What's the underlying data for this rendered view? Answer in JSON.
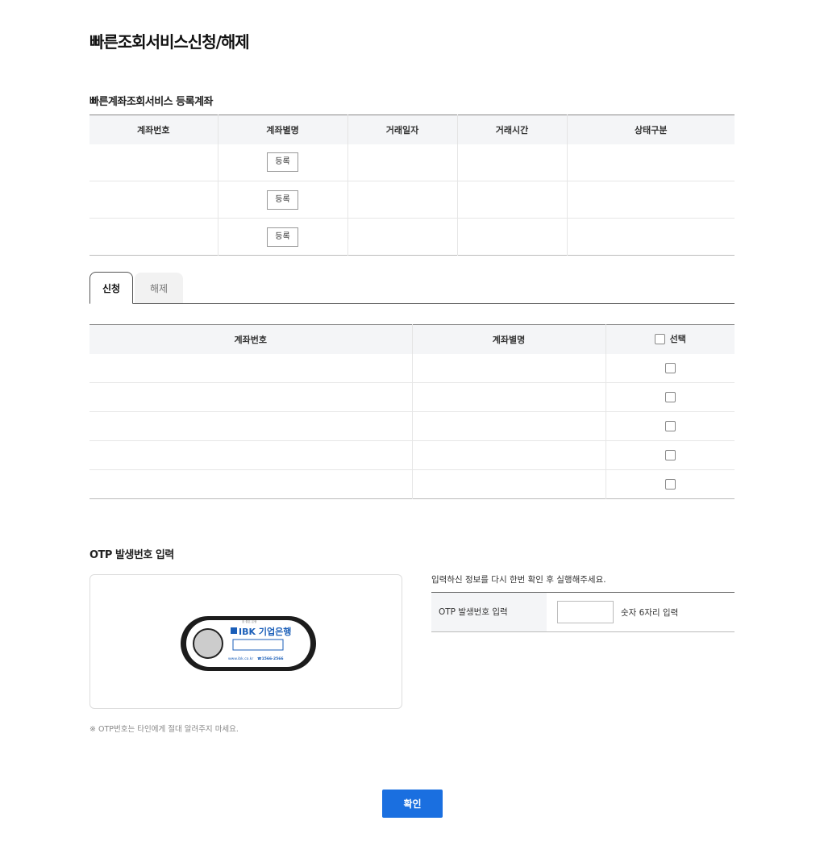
{
  "page": {
    "title": "빠른조회서비스신청/해제"
  },
  "registered": {
    "title": "빠른계좌조회서비스 등록계좌",
    "columns": [
      "계좌번호",
      "계좌별명",
      "거래일자",
      "거래시간",
      "상태구분"
    ],
    "rows": [
      {
        "account": "",
        "alias_button": "등록",
        "date": "",
        "time": "",
        "status": ""
      },
      {
        "account": "",
        "alias_button": "등록",
        "date": "",
        "time": "",
        "status": ""
      },
      {
        "account": "",
        "alias_button": "등록",
        "date": "",
        "time": "",
        "status": ""
      }
    ]
  },
  "tabs": [
    {
      "label": "신청",
      "active": true
    },
    {
      "label": "해제",
      "active": false
    }
  ],
  "selection": {
    "columns": [
      "계좌번호",
      "계좌별명",
      "선택"
    ],
    "rows": [
      {
        "account": "",
        "alias": "",
        "checked": false
      },
      {
        "account": "",
        "alias": "",
        "checked": false
      },
      {
        "account": "",
        "alias": "",
        "checked": false
      },
      {
        "account": "",
        "alias": "",
        "checked": false
      },
      {
        "account": "",
        "alias": "",
        "checked": false
      }
    ]
  },
  "otp": {
    "title": "OTP 발생번호 입력",
    "device": {
      "tagline": "참 좋은 은행",
      "brand": "IBK 기업은행",
      "url": "www.ibk.co.kr",
      "phone": "☎1566-2566"
    },
    "guide": "입력하신 정보를 다시 한번 확인 후 실행해주세요.",
    "field_label": "OTP 발생번호 입력",
    "input_value": "",
    "hint": "숫자 6자리 입력",
    "warning": "※ OTP번호는 타인에게 절대 알려주지 마세요."
  },
  "confirm_label": "확인",
  "colors": {
    "accent": "#1a6fe0",
    "brand": "#1a5eb8"
  }
}
